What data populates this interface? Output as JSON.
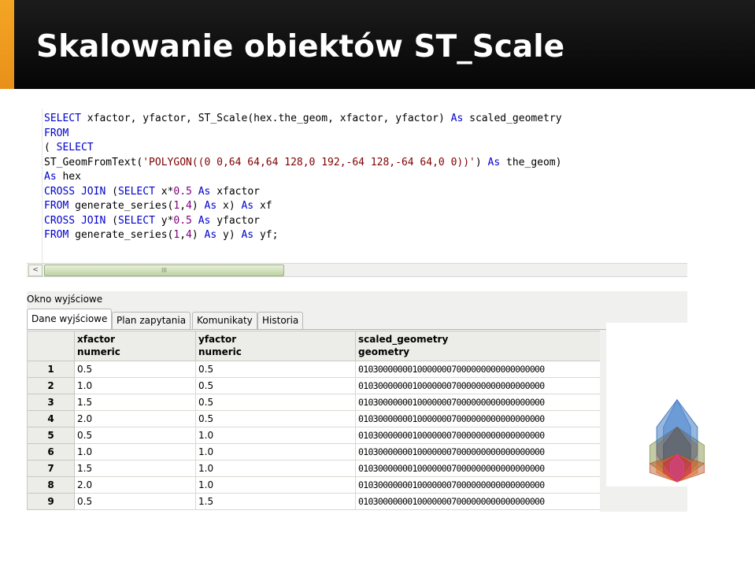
{
  "slide": {
    "title": "Skalowanie obiektów ST_Scale"
  },
  "editor": {
    "sql_lines": [
      "SELECT xfactor, yfactor, ST_Scale(hex.the_geom, xfactor, yfactor) As scaled_geometry",
      "FROM",
      "( SELECT",
      "ST_GeomFromText('POLYGON((0 0,64 64,64 128,0 192,-64 128,-64 64,0 0))') As the_geom)",
      "As hex",
      "CROSS JOIN (SELECT x*0.5 As xfactor",
      "FROM generate_series(1,4) As x) As xf",
      "CROSS JOIN (SELECT y*0.5 As yfactor",
      "FROM generate_series(1,4) As y) As yf;"
    ],
    "scroll_left_glyph": "<",
    "scroll_thumb_glyph": "III"
  },
  "output": {
    "panel_title": "Okno wyjściowe",
    "tabs": [
      {
        "label": "Dane wyjściowe",
        "active": true
      },
      {
        "label": "Plan zapytania",
        "active": false
      },
      {
        "label": "Komunikaty",
        "active": false
      },
      {
        "label": "Historia",
        "active": false
      }
    ],
    "columns": [
      {
        "name": "xfactor",
        "type": "numeric"
      },
      {
        "name": "yfactor",
        "type": "numeric"
      },
      {
        "name": "scaled_geometry",
        "type": "geometry"
      }
    ],
    "rows": [
      {
        "n": "1",
        "x": "0.5",
        "y": "0.5",
        "g": "01030000000100000007000000000000000000"
      },
      {
        "n": "2",
        "x": "1.0",
        "y": "0.5",
        "g": "01030000000100000007000000000000000000"
      },
      {
        "n": "3",
        "x": "1.5",
        "y": "0.5",
        "g": "01030000000100000007000000000000000000"
      },
      {
        "n": "4",
        "x": "2.0",
        "y": "0.5",
        "g": "01030000000100000007000000000000000000"
      },
      {
        "n": "5",
        "x": "0.5",
        "y": "1.0",
        "g": "01030000000100000007000000000000000000"
      },
      {
        "n": "6",
        "x": "1.0",
        "y": "1.0",
        "g": "01030000000100000007000000000000000000"
      },
      {
        "n": "7",
        "x": "1.5",
        "y": "1.0",
        "g": "01030000000100000007000000000000000000"
      },
      {
        "n": "8",
        "x": "2.0",
        "y": "1.0",
        "g": "01030000000100000007000000000000000000"
      },
      {
        "n": "9",
        "x": "0.5",
        "y": "1.5",
        "g": "01030000000100000007000000000000000000"
      }
    ]
  },
  "figure": {
    "polygons": [
      {
        "sx": 2.0,
        "sy": 1.0,
        "color": "#7a8c3a"
      },
      {
        "sx": 1.5,
        "sy": 1.5,
        "color": "#1a5fb0"
      },
      {
        "sx": 1.0,
        "sy": 1.5,
        "color": "#3a7ad0"
      },
      {
        "sx": 2.0,
        "sy": 0.5,
        "color": "#b85020"
      },
      {
        "sx": 1.5,
        "sy": 1.0,
        "color": "#8c6a58"
      },
      {
        "sx": 1.0,
        "sy": 1.0,
        "color": "#555555"
      },
      {
        "sx": 1.5,
        "sy": 0.5,
        "color": "#e06a20"
      },
      {
        "sx": 1.0,
        "sy": 0.5,
        "color": "#e02050"
      },
      {
        "sx": 0.5,
        "sy": 0.5,
        "color": "#e040a0"
      }
    ]
  }
}
